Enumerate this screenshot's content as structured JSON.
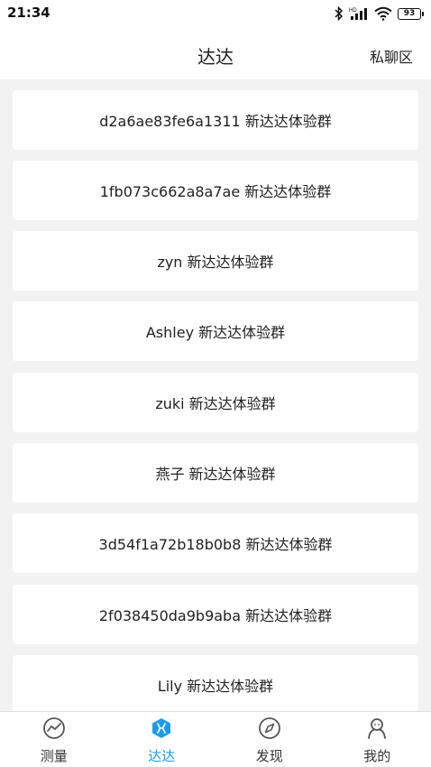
{
  "status_bar": {
    "time": "21:34",
    "network_label": "HD",
    "battery_level": "93",
    "icons": [
      "bluetooth-icon",
      "signal-icon",
      "wifi-icon",
      "battery-icon"
    ]
  },
  "header": {
    "title": "达达",
    "action_label": "私聊区"
  },
  "groups": [
    {
      "label": "d2a6ae83fe6a1311 新达达体验群"
    },
    {
      "label": "1fb073c662a8a7ae 新达达体验群"
    },
    {
      "label": "zyn 新达达体验群"
    },
    {
      "label": "Ashley  新达达体验群"
    },
    {
      "label": "zuki 新达达体验群"
    },
    {
      "label": "燕子 新达达体验群"
    },
    {
      "label": "3d54f1a72b18b0b8 新达达体验群"
    },
    {
      "label": "2f038450da9b9aba 新达达体验群"
    },
    {
      "label": "Lily 新达达体验群"
    }
  ],
  "tab_bar": {
    "active_index": 1,
    "active_color": "#1f9ce8",
    "tabs": [
      {
        "label": "测量",
        "icon": "chart-circle-icon"
      },
      {
        "label": "达达",
        "icon": "hexagon-logo-icon"
      },
      {
        "label": "发现",
        "icon": "compass-icon"
      },
      {
        "label": "我的",
        "icon": "person-icon"
      }
    ]
  }
}
